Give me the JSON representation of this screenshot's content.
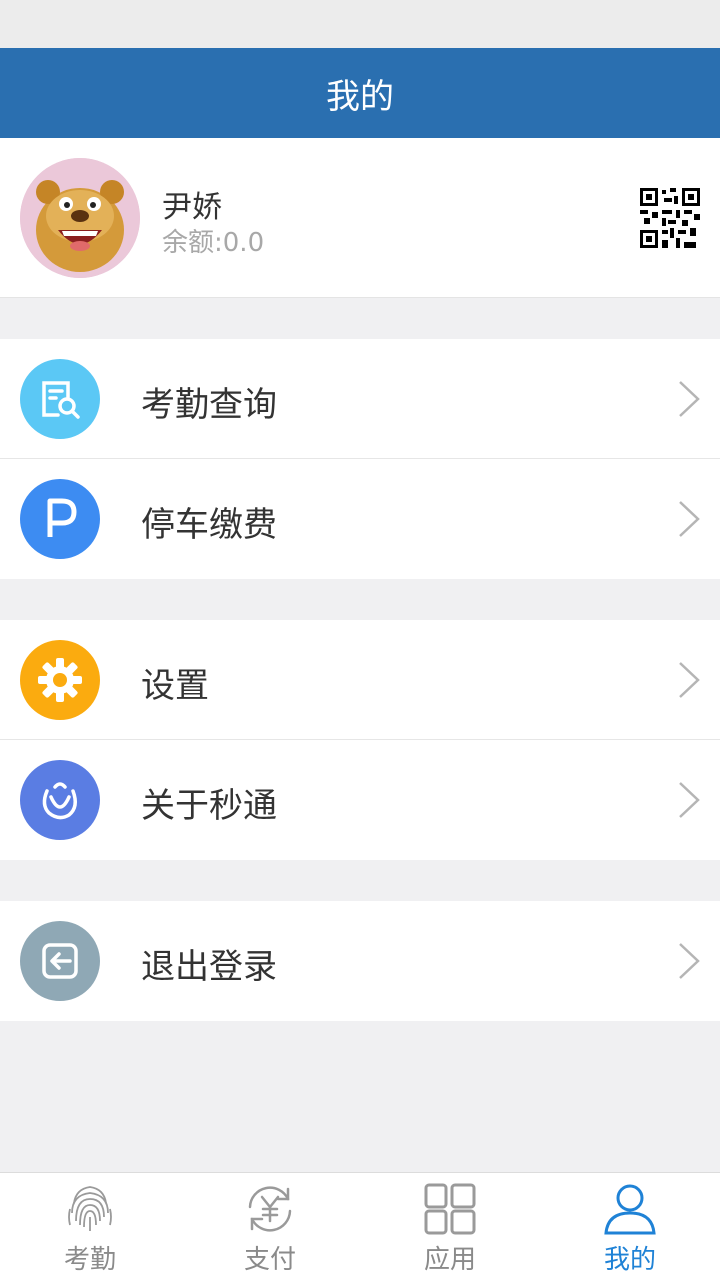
{
  "header": {
    "title": "我的"
  },
  "profile": {
    "name": "尹娇",
    "balance": "余额:0.0"
  },
  "menu": {
    "group1": [
      {
        "label": "考勤查询",
        "icon": "attendance-search-icon",
        "color": "#5bc8f5"
      },
      {
        "label": "停车缴费",
        "icon": "parking-icon",
        "color": "#3d8cf2"
      }
    ],
    "group2": [
      {
        "label": "设置",
        "icon": "gear-icon",
        "color": "#fbab0f"
      },
      {
        "label": "关于秒通",
        "icon": "app-logo-icon",
        "color": "#5a7de3"
      }
    ],
    "group3": [
      {
        "label": "退出登录",
        "icon": "logout-icon",
        "color": "#8fa8b5"
      }
    ]
  },
  "tabs": [
    {
      "label": "考勤",
      "icon": "fingerprint-icon"
    },
    {
      "label": "支付",
      "icon": "yuan-exchange-icon"
    },
    {
      "label": "应用",
      "icon": "apps-icon"
    },
    {
      "label": "我的",
      "icon": "person-icon",
      "active": true
    }
  ],
  "colors": {
    "accent": "#2a6fb0",
    "active_tab": "#1f82d6"
  }
}
